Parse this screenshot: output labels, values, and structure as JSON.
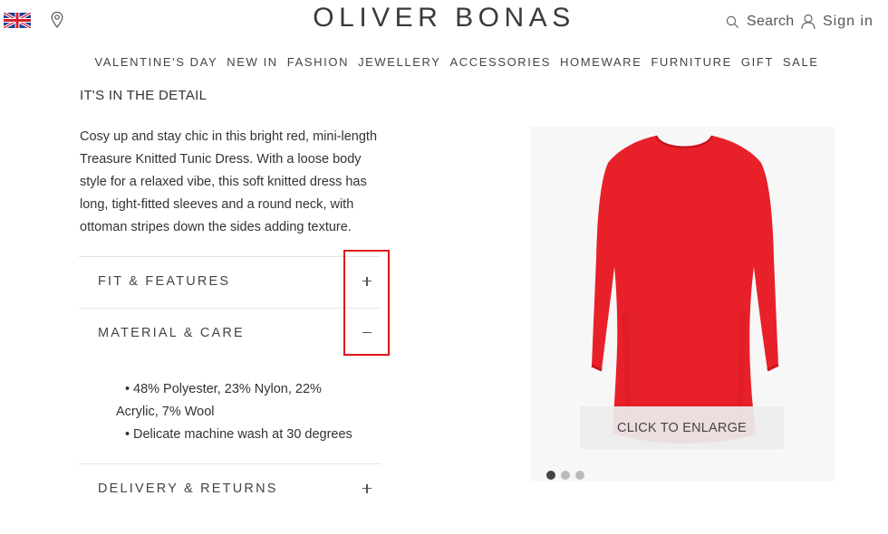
{
  "header": {
    "logo": "OLIVER BONAS",
    "search_label": "Search",
    "signin_label": "Sign in"
  },
  "nav": [
    "VALENTINE'S DAY",
    "NEW IN",
    "FASHION",
    "JEWELLERY",
    "ACCESSORIES",
    "HOMEWARE",
    "FURNITURE",
    "GIFT",
    "SALE"
  ],
  "detail": {
    "heading": "IT'S IN THE DETAIL",
    "description": "Cosy up and stay chic in this bright red, mini-length Treasure Knitted Tunic Dress. With a loose body style for a relaxed vibe, this soft knitted dress has long, tight-fitted sleeves and a round neck, with ottoman stripes down the sides adding texture."
  },
  "accordion": {
    "fit_label": "FIT & FEATURES",
    "material_label": "MATERIAL & CARE",
    "material_items": [
      "48% Polyester, 23% Nylon, 22% Acrylic, 7% Wool",
      "Delicate machine wash at 30 degrees"
    ],
    "delivery_label": "DELIVERY & RETURNS"
  },
  "gallery": {
    "enlarge_label": "CLICK TO ENLARGE",
    "image_count": 3,
    "active_index": 0
  },
  "colors": {
    "dress_red": "#e8202a",
    "highlight": "#e0151d",
    "dot_active": "#444444",
    "dot_inactive": "#bbbbbb"
  },
  "icons": [
    "uk-flag-icon",
    "location-pin-icon",
    "search-icon",
    "user-icon",
    "plus-icon",
    "minus-icon"
  ]
}
